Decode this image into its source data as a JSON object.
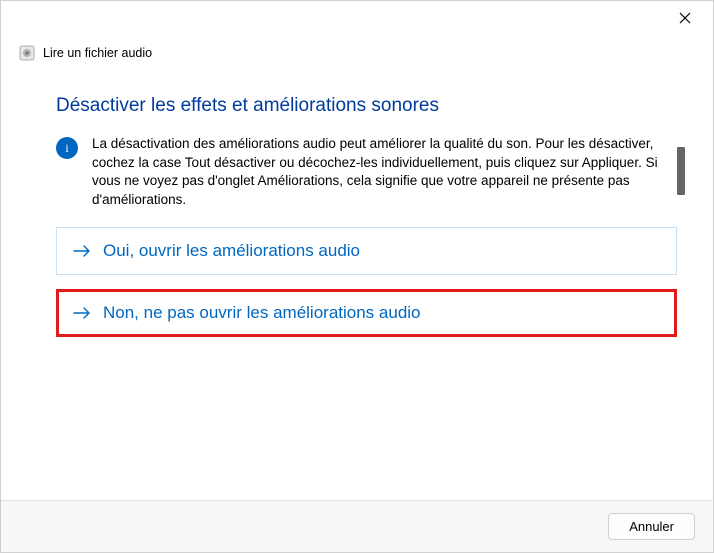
{
  "window": {
    "title": "Lire un fichier audio"
  },
  "main": {
    "heading": "Désactiver les effets et améliorations sonores",
    "info_text": "La désactivation des améliorations audio peut améliorer la qualité du son. Pour les désactiver, cochez la case Tout désactiver ou décochez-les individuellement, puis cliquez sur Appliquer. Si vous ne voyez pas d'onglet Améliorations, cela signifie que votre appareil ne présente pas d'améliorations."
  },
  "options": {
    "yes": "Oui, ouvrir les améliorations audio",
    "no": "Non, ne pas ouvrir les améliorations audio"
  },
  "footer": {
    "cancel": "Annuler"
  }
}
